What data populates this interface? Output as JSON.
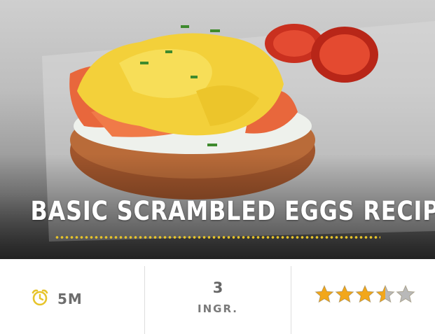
{
  "recipe": {
    "title": "BASIC SCRAMBLED EGGS RECIPE",
    "time": "5M",
    "ingredients_count": "3",
    "ingredients_label": "INGR.",
    "rating": 3.5,
    "rating_max": 5
  },
  "icons": {
    "time": "alarm-clock-icon",
    "rating": "star-icon"
  },
  "colors": {
    "accent": "#e7c42b",
    "star_fill": "#f2a71b",
    "star_empty": "#b9b9b9",
    "text_muted": "#6d6d6d"
  }
}
